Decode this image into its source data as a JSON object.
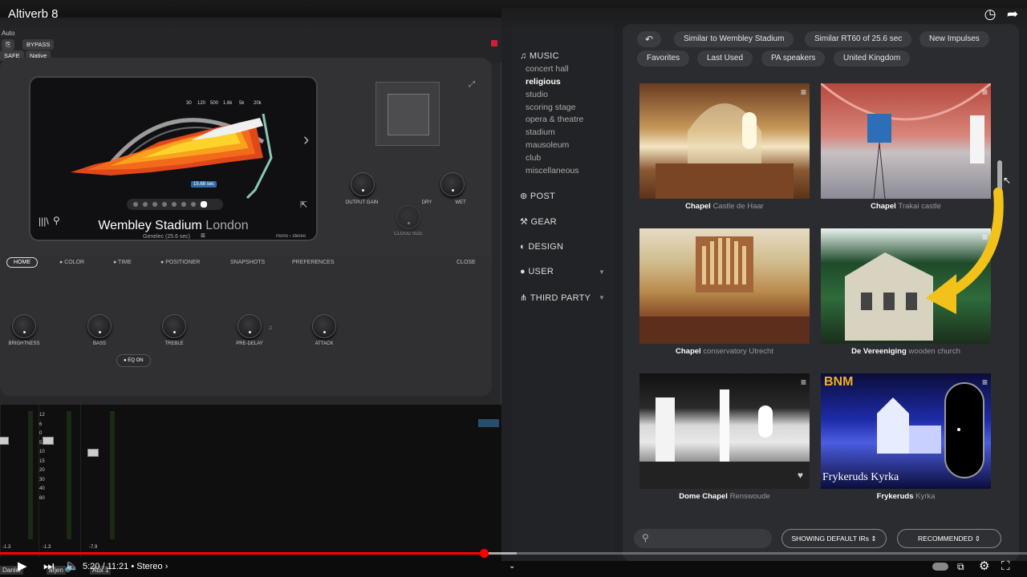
{
  "video": {
    "title": "Altiverb 8",
    "time": "5:20 / 11:21 • Stereo ›"
  },
  "plugin": {
    "auto_label": "Auto",
    "bypass": "BYPASS",
    "safe": "SAFE",
    "native": "Native",
    "ir_name": "Wembley Stadium",
    "ir_location": "London",
    "ir_sub": "Genelec (25.6 sec)",
    "mode": "mono › stereo",
    "rt_badge": "15.68 sec",
    "freq_ticks": [
      "30",
      "120",
      "500",
      "1.6k",
      "5k",
      "20k"
    ],
    "knobs_top": [
      {
        "label": "OUTPUT GAIN"
      },
      {
        "label": "DRY"
      },
      {
        "label": "WET"
      },
      {
        "label": "CLOUD SIZE"
      }
    ],
    "tabs": [
      "HOME",
      "COLOR",
      "TIME",
      "POSITIONER",
      "SNAPSHOTS",
      "PREFERENCES",
      "CLOSE"
    ],
    "knobs_bottom": [
      "BRIGHTNESS",
      "BASS",
      "TREBLE",
      "PRE-DELAY",
      "ATTACK"
    ],
    "eq_on": "EQ ON"
  },
  "mixer": {
    "values": [
      "-1.3",
      "-1.3",
      "-7.9"
    ],
    "channels": [
      "Danlel",
      "arjen",
      "Aux 1"
    ],
    "scale": [
      "12",
      "6",
      "0",
      "5",
      "10",
      "15",
      "20",
      "30",
      "40",
      "60"
    ]
  },
  "browser": {
    "categories": {
      "music": "MUSIC",
      "music_items": [
        "concert hall",
        "religious",
        "studio",
        "scoring stage",
        "opera & theatre",
        "stadium",
        "mausoleum",
        "club",
        "miscellaneous"
      ],
      "post": "POST",
      "gear": "GEAR",
      "design": "DESIGN",
      "user": "USER",
      "third_party": "THIRD PARTY"
    },
    "chips_row1": [
      "Similar to Wembley Stadium",
      "Similar RT60 of 25.6 sec",
      "New Impulses"
    ],
    "chips_row2": [
      "Favorites",
      "Last Used",
      "PA speakers",
      "United Kingdom"
    ],
    "tiles": [
      {
        "name": "Chapel",
        "place": "Castle de Haar"
      },
      {
        "name": "Chapel",
        "place": "Trakai castle"
      },
      {
        "name": "Chapel",
        "place": "conservatory Utrecht"
      },
      {
        "name": "De Vereeniging",
        "place": "wooden church"
      },
      {
        "name": "Dome Chapel",
        "place": "Renswoude"
      },
      {
        "name": "Frykeruds",
        "place": "Kyrka"
      }
    ],
    "poster_title": "Frykeruds Kyrka",
    "poster_logo": "BNM",
    "showing": "SHOWING DEFAULT IRs",
    "sort": "RECOMMENDED"
  },
  "colors": {
    "accent_arrow": "#f2c21b",
    "progress": "#ff0000"
  }
}
